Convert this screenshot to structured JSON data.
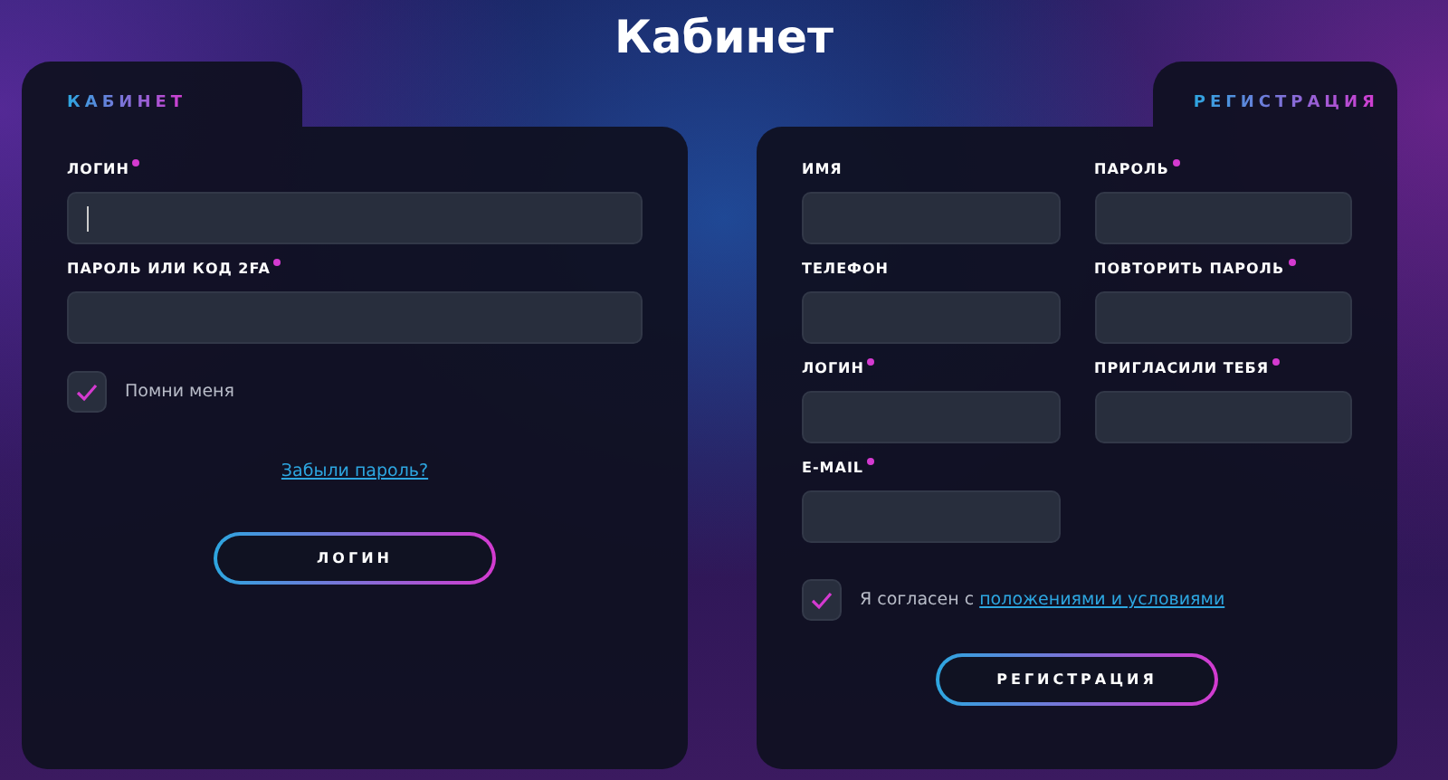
{
  "title": "Кабинет",
  "login_panel": {
    "tab": "КАБИНЕТ",
    "fields": [
      {
        "label": "ЛОГИН",
        "required": true,
        "focused": true
      },
      {
        "label": "ПАРОЛЬ ИЛИ КОД 2FA",
        "required": true,
        "focused": false
      }
    ],
    "remember": {
      "label": "Помни меня",
      "checked": true
    },
    "forgot_link": "Забыли пароль?",
    "button": "ЛОГИН"
  },
  "register_panel": {
    "tab": "РЕГИСТРАЦИЯ",
    "fields": [
      {
        "label": "ИМЯ",
        "required": false
      },
      {
        "label": "ПАРОЛЬ",
        "required": true
      },
      {
        "label": "ТЕЛЕФОН",
        "required": false
      },
      {
        "label": "ПОВТОРИТЬ ПАРОЛЬ",
        "required": true
      },
      {
        "label": "ЛОГИН",
        "required": true
      },
      {
        "label": "ПРИГЛАСИЛИ ТЕБЯ",
        "required": true
      },
      {
        "label": "E-MAIL",
        "required": true
      }
    ],
    "agree": {
      "text": "Я согласен с",
      "link": "положениями и условиями",
      "checked": true
    },
    "button": "РЕГИСТРАЦИЯ"
  }
}
